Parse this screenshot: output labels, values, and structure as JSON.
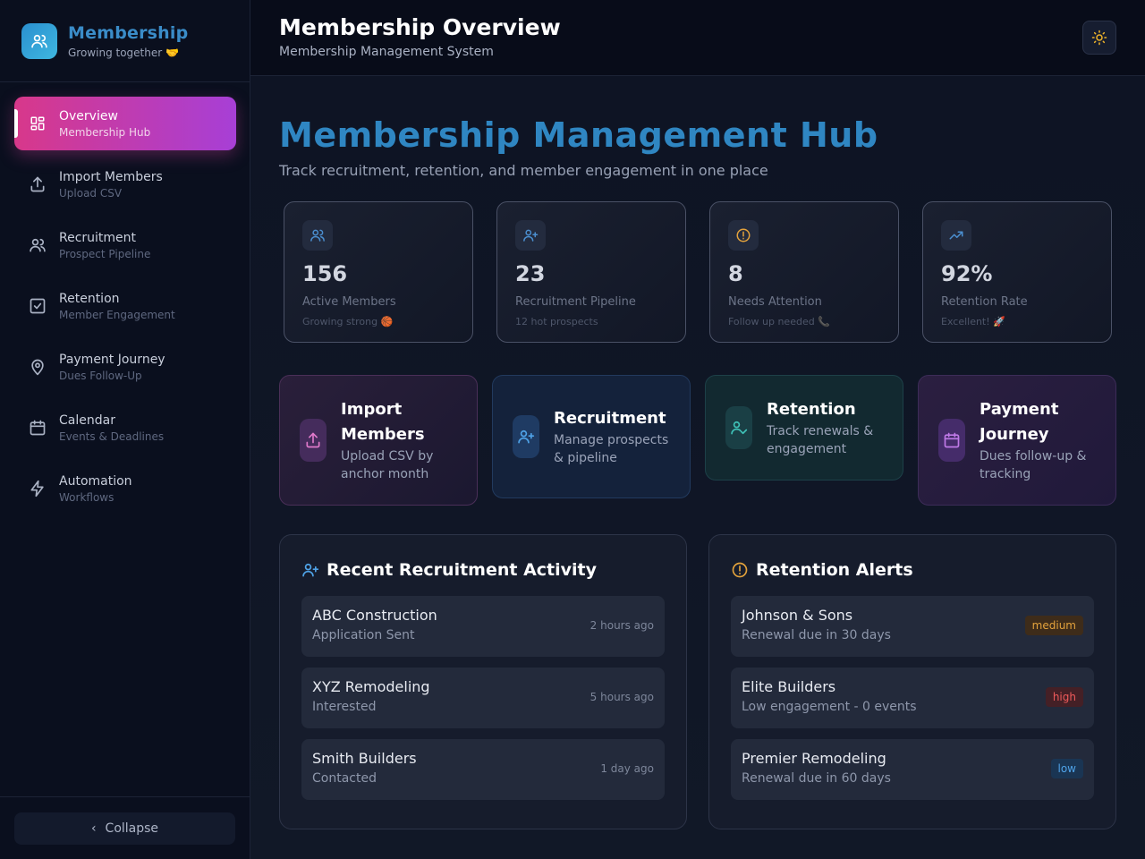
{
  "brand": {
    "title": "Membership",
    "subtitle": "Growing together 🤝"
  },
  "nav": [
    {
      "label": "Overview",
      "sub": "Membership Hub",
      "icon": "dashboard-icon"
    },
    {
      "label": "Import Members",
      "sub": "Upload CSV",
      "icon": "upload-icon"
    },
    {
      "label": "Recruitment",
      "sub": "Prospect Pipeline",
      "icon": "users-icon"
    },
    {
      "label": "Retention",
      "sub": "Member Engagement",
      "icon": "checkbox-icon"
    },
    {
      "label": "Payment Journey",
      "sub": "Dues Follow-Up",
      "icon": "map-pin-icon"
    },
    {
      "label": "Calendar",
      "sub": "Events & Deadlines",
      "icon": "calendar-icon"
    },
    {
      "label": "Automation",
      "sub": "Workflows",
      "icon": "lightning-icon"
    }
  ],
  "collapse_label": "Collapse",
  "header": {
    "title": "Membership Overview",
    "subtitle": "Membership Management System"
  },
  "hub": {
    "title": "Membership Management Hub",
    "subtitle": "Track recruitment, retention, and member engagement in one place"
  },
  "stats": [
    {
      "value": "156",
      "label": "Active Members",
      "note": "Growing strong 🏀",
      "icon": "users-icon"
    },
    {
      "value": "23",
      "label": "Recruitment Pipeline",
      "note": "12 hot prospects",
      "icon": "user-plus-icon"
    },
    {
      "value": "8",
      "label": "Needs Attention",
      "note": "Follow up needed 📞",
      "icon": "alert-circle-icon"
    },
    {
      "value": "92%",
      "label": "Retention Rate",
      "note": "Excellent! 🚀",
      "icon": "trending-up-icon"
    }
  ],
  "actions": [
    {
      "title": "Import Members",
      "sub": "Upload CSV by anchor month",
      "icon": "upload-icon"
    },
    {
      "title": "Recruitment",
      "sub": "Manage prospects & pipeline",
      "icon": "user-plus-icon"
    },
    {
      "title": "Retention",
      "sub": "Track renewals & engagement",
      "icon": "user-check-icon"
    },
    {
      "title": "Payment Journey",
      "sub": "Dues follow-up & tracking",
      "icon": "calendar-icon"
    }
  ],
  "recruitment": {
    "title": "Recent Recruitment Activity",
    "items": [
      {
        "name": "ABC Construction",
        "status": "Application Sent",
        "time": "2 hours ago"
      },
      {
        "name": "XYZ Remodeling",
        "status": "Interested",
        "time": "5 hours ago"
      },
      {
        "name": "Smith Builders",
        "status": "Contacted",
        "time": "1 day ago"
      }
    ]
  },
  "retention": {
    "title": "Retention Alerts",
    "items": [
      {
        "name": "Johnson & Sons",
        "detail": "Renewal due in 30 days",
        "priority": "medium"
      },
      {
        "name": "Elite Builders",
        "detail": "Low engagement - 0 events",
        "priority": "high"
      },
      {
        "name": "Premier Remodeling",
        "detail": "Renewal due in 60 days",
        "priority": "low"
      }
    ]
  },
  "colors": {
    "accent_pink": "#d8388a",
    "accent_purple": "#a73fd6",
    "brand_blue": "#2f86c2",
    "medium": "#e3a23c",
    "high": "#ef5a5a",
    "low": "#4fa3e8"
  }
}
